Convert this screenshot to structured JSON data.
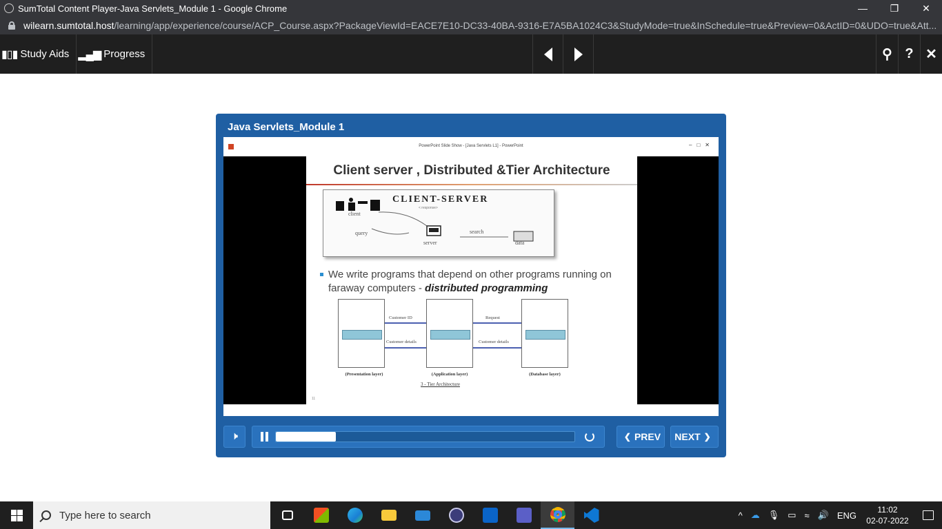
{
  "browser": {
    "window_title": "SumTotal Content Player-Java Servlets_Module 1 - Google Chrome",
    "url_host": "wilearn.sumtotal.host",
    "url_path": "/learning/app/experience/course/ACP_Course.aspx?PackageViewId=EACE7E10-DC33-40BA-9316-E7A5BA1024C3&StudyMode=true&InSchedule=true&Preview=0&ActID=0&UDO=true&Att..."
  },
  "toolbar": {
    "study_aids_label": "Study Aids",
    "progress_label": "Progress"
  },
  "player": {
    "title": "Java Servlets_Module 1",
    "ppt_window_title": "PowerPoint Slide Show - [Java Servlets L1] - PowerPoint",
    "progress_fraction": 0.2,
    "prev_label": "PREV",
    "next_label": "NEXT"
  },
  "slide": {
    "heading": "Client server , Distributed &Tier Architecture",
    "cs_diagram": {
      "title": "CLIENT-SERVER",
      "client_label": "client",
      "query_label": "query",
      "server_label": "server",
      "search_label": "search",
      "data_label": "data"
    },
    "bullet_text": "We write programs that depend on other programs running on faraway computers - ",
    "bullet_emphasis": "distributed programming",
    "tier_diagram": {
      "link_top_1": "Customer ID",
      "link_bottom_1": "Customer details",
      "link_top_2": "Request",
      "link_bottom_2": "Customer details",
      "caption_1": "(Presentation layer)",
      "caption_2": "(Application layer)",
      "caption_3": "(Database layer)",
      "title": "3 - Tier Architecture"
    },
    "slide_number": "11"
  },
  "taskbar": {
    "search_placeholder": "Type here to search",
    "language": "ENG",
    "time": "11:02",
    "date": "02-07-2022"
  },
  "colors": {
    "player_blue": "#1f5fa3",
    "toolbar_dark": "#1f1f1f",
    "chrome_dark": "#35363a"
  }
}
